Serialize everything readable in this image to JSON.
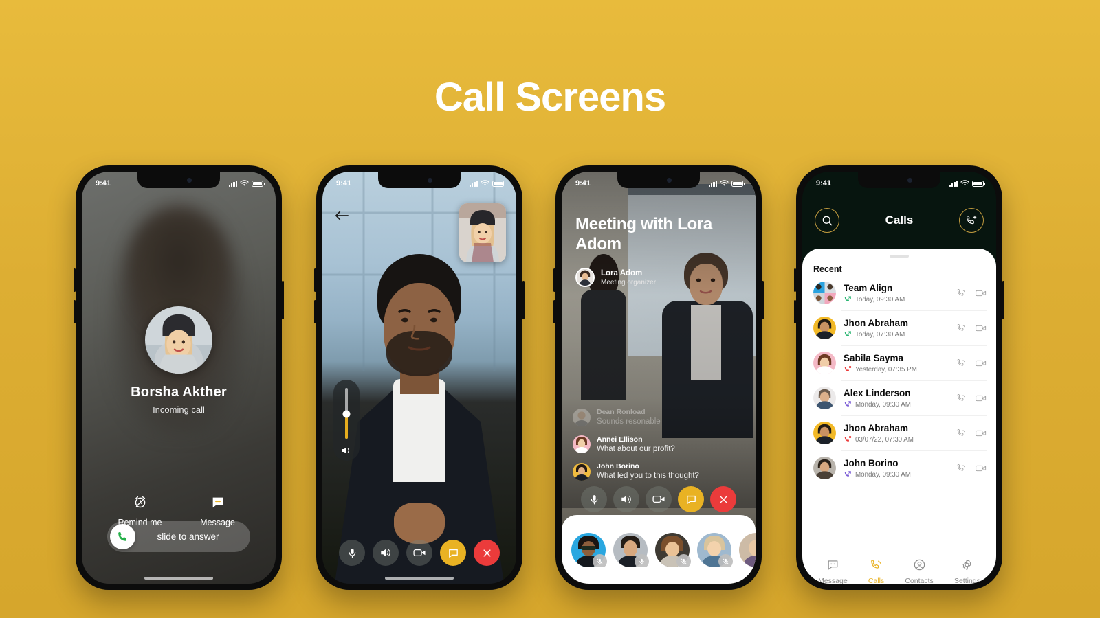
{
  "page": {
    "title": "Call Screens",
    "background_color": "#ddae33",
    "accent_gold": "#e9b223",
    "accent_green": "#2bb673",
    "accent_red": "#eb3b3b",
    "accent_purple": "#7b5cd6"
  },
  "status_bar": {
    "time": "9:41",
    "signal_icon": "signal-bars-icon",
    "wifi_icon": "wifi-icon",
    "battery_icon": "battery-icon"
  },
  "phone1": {
    "name": "incoming-call-screen",
    "caller_name": "Borsha Akther",
    "call_status": "Incoming call",
    "actions": [
      {
        "label": "Remind me",
        "icon": "alarm-clock-icon"
      },
      {
        "label": "Message",
        "icon": "chat-bubble-icon"
      }
    ],
    "slider": {
      "label": "slide to answer",
      "icon": "phone-icon"
    }
  },
  "phone2": {
    "name": "video-call-screen",
    "back_icon": "back-arrow-icon",
    "pip_icon": "self-view-thumbnail",
    "volume": {
      "icon": "speaker-icon",
      "level_percent": 46
    },
    "controls": [
      {
        "name": "mic-button",
        "icon": "microphone-icon",
        "style": "dim"
      },
      {
        "name": "speaker-button",
        "icon": "speaker-icon",
        "style": "dim"
      },
      {
        "name": "video-button",
        "icon": "video-camera-icon",
        "style": "dim"
      },
      {
        "name": "chat-button",
        "icon": "chat-bubble-icon",
        "style": "gold"
      },
      {
        "name": "end-call-button",
        "icon": "close-x-icon",
        "style": "red"
      }
    ]
  },
  "phone3": {
    "name": "meeting-screen",
    "title": "Meeting with Lora Adom",
    "organizer": {
      "name": "Lora Adom",
      "role": "Meeting organizer"
    },
    "chat": [
      {
        "name": "Dean Ronload",
        "message": "Sounds resonable",
        "faded": true
      },
      {
        "name": "Annei Ellison",
        "message": "What about our profit?",
        "faded": false
      },
      {
        "name": "John Borino",
        "message": "What led you to this thought?",
        "faded": false
      }
    ],
    "controls": [
      {
        "name": "mic-button",
        "icon": "microphone-icon",
        "style": "dim"
      },
      {
        "name": "speaker-button",
        "icon": "speaker-icon",
        "style": "dim"
      },
      {
        "name": "video-button",
        "icon": "video-camera-icon",
        "style": "dim"
      },
      {
        "name": "chat-button",
        "icon": "chat-bubble-icon",
        "style": "gold"
      },
      {
        "name": "end-call-button",
        "icon": "close-x-icon",
        "style": "red"
      }
    ],
    "participants": [
      {
        "muted": true
      },
      {
        "muted": false
      },
      {
        "muted": true
      },
      {
        "muted": true
      },
      {
        "muted": true
      }
    ]
  },
  "phone4": {
    "name": "calls-list-screen",
    "header": {
      "title": "Calls",
      "search_icon": "search-icon",
      "add_call_icon": "add-call-icon"
    },
    "section_label": "Recent",
    "calls": [
      {
        "name": "Team Align",
        "time": "Today, 09:30 AM",
        "direction": "incoming",
        "direction_color": "#2bb673"
      },
      {
        "name": "Jhon Abraham",
        "time": "Today, 07:30 AM",
        "direction": "incoming",
        "direction_color": "#2bb673"
      },
      {
        "name": "Sabila Sayma",
        "time": "Yesterday, 07:35 PM",
        "direction": "missed",
        "direction_color": "#eb3b3b"
      },
      {
        "name": "Alex Linderson",
        "time": "Monday, 09:30 AM",
        "direction": "outgoing",
        "direction_color": "#7b5cd6"
      },
      {
        "name": "Jhon Abraham",
        "time": "03/07/22, 07:30 AM",
        "direction": "missed",
        "direction_color": "#eb3b3b"
      },
      {
        "name": "John Borino",
        "time": "Monday, 09:30 AM",
        "direction": "outgoing",
        "direction_color": "#7b5cd6"
      }
    ],
    "row_actions": {
      "call_icon": "phone-icon",
      "video_icon": "video-camera-icon"
    },
    "nav": [
      {
        "label": "Message",
        "icon": "chat-bubble-icon",
        "active": false
      },
      {
        "label": "Calls",
        "icon": "phone-icon",
        "active": true
      },
      {
        "label": "Contacts",
        "icon": "person-icon",
        "active": false
      },
      {
        "label": "Settings",
        "icon": "gear-icon",
        "active": false
      }
    ]
  }
}
